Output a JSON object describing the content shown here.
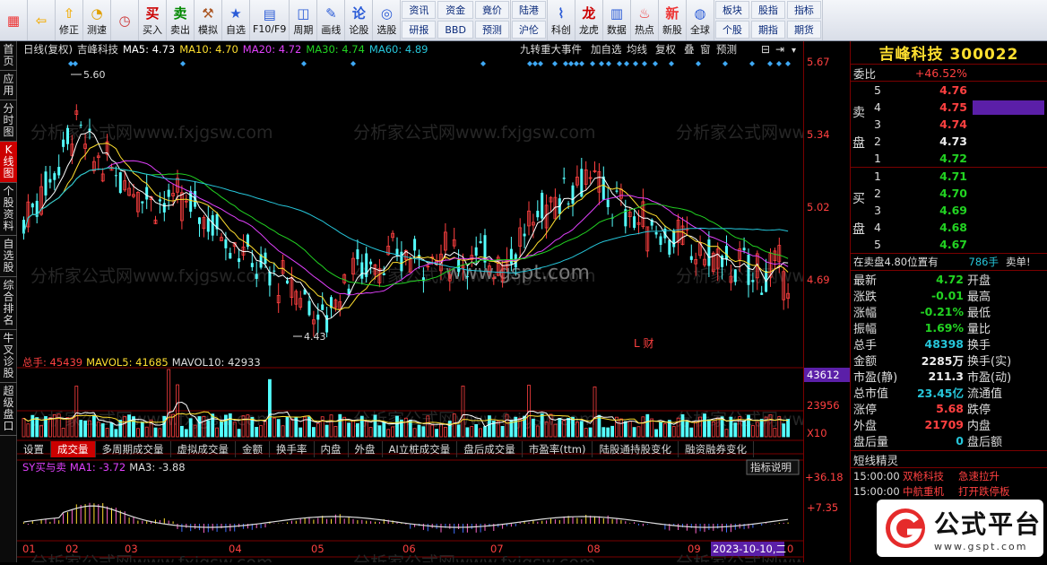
{
  "toolbar": {
    "buttons": [
      {
        "label": "",
        "icon": "grid-icon"
      },
      {
        "label": "",
        "icon": "back-arrow-icon"
      },
      {
        "label": "修正",
        "icon": "up-icon"
      },
      {
        "label": "测速",
        "icon": "speed-icon"
      },
      {
        "label": "",
        "icon": "clock-icon"
      },
      {
        "label": "买入",
        "icon": "buy-icon"
      },
      {
        "label": "卖出",
        "icon": "sell-icon"
      },
      {
        "label": "模拟",
        "icon": "hammer-icon"
      },
      {
        "label": "自选",
        "icon": "star-icon"
      },
      {
        "label": "F10/F9",
        "icon": "f10-icon"
      },
      {
        "label": "周期",
        "icon": "cycle-icon"
      },
      {
        "label": "画线",
        "icon": "pencil-icon"
      },
      {
        "label": "论股",
        "icon": "forum-icon"
      },
      {
        "label": "选股",
        "icon": "pick-icon"
      }
    ],
    "grid1": [
      "资讯",
      "资金",
      "竟价",
      "研报",
      "BBD",
      "预测"
    ],
    "grid1b": [
      "陆港",
      "沪伦"
    ],
    "buttons2": [
      {
        "label": "科创",
        "icon": "kc-icon"
      },
      {
        "label": "龙虎",
        "icon": "dragon-icon"
      },
      {
        "label": "数据",
        "icon": "data-icon"
      },
      {
        "label": "热点",
        "icon": "hot-icon"
      },
      {
        "label": "新股",
        "icon": "newstock-icon"
      },
      {
        "label": "全球",
        "icon": "globe-icon"
      }
    ],
    "grid2": [
      "板块",
      "股指",
      "指标",
      "个股",
      "期指",
      "期货"
    ]
  },
  "leftnav": [
    "首页",
    "应用",
    "分时图",
    "K线图",
    "个股资料",
    "自选股",
    "综合排名",
    "牛叉诊股",
    "超级盘口"
  ],
  "chart": {
    "info_bar": {
      "period": "日线(复权)",
      "name": "吉峰科技",
      "ma5": "MA5: 4.73",
      "ma10": "MA10: 4.70",
      "ma20": "MA20: 4.72",
      "ma30": "MA30: 4.74",
      "ma60": "MA60: 4.89"
    },
    "right_buttons": [
      "九转",
      "重大事件",
      "加自选",
      "均线",
      "复权",
      "叠",
      "窗",
      "预测"
    ],
    "price_ticks": [
      "5.67",
      "5.34",
      "5.02",
      "4.69"
    ],
    "high_label": "5.60",
    "low_label": "4.43",
    "event_tag": "L 财",
    "vol_info": {
      "total": "总手: 45439",
      "mavol5": "MAVOL5: 41685",
      "mavol10": "MAVOL10: 42933"
    },
    "vol_ticks": [
      "43612",
      "23956",
      "X10"
    ],
    "tabs": [
      "设置",
      "成交量",
      "多周期成交量",
      "虚拟成交量",
      "金额",
      "换手率",
      "内盘",
      "外盘",
      "AI立桩成交量",
      "盘后成交量",
      "市盈率(ttm)",
      "陆股通持股变化",
      "融资融券变化"
    ],
    "ind_info": {
      "name": "SY买与卖",
      "ma1": "MA1: -3.72",
      "ma3": "MA3: -3.88"
    },
    "ind_button": "指标说明",
    "ind_ticks": [
      "+36.18",
      "+7.35"
    ],
    "months": [
      "01",
      "02",
      "03",
      "04",
      "05",
      "06",
      "07",
      "08",
      "09"
    ],
    "date_label": "2023-10-10,二",
    "right_zero": "0",
    "watermark_site": "www.gspt.com"
  },
  "quote": {
    "title": "吉峰科技 300022",
    "weibi_label": "委比",
    "weibi": "+46.52%",
    "sell_label": "卖盘",
    "buy_label": "买盘",
    "sells": [
      {
        "lvl": "5",
        "price": "4.76"
      },
      {
        "lvl": "4",
        "price": "4.75"
      },
      {
        "lvl": "3",
        "price": "4.74"
      },
      {
        "lvl": "2",
        "price": "4.73"
      },
      {
        "lvl": "1",
        "price": "4.72"
      }
    ],
    "buys": [
      {
        "lvl": "1",
        "price": "4.71"
      },
      {
        "lvl": "2",
        "price": "4.70"
      },
      {
        "lvl": "3",
        "price": "4.69"
      },
      {
        "lvl": "4",
        "price": "4.68"
      },
      {
        "lvl": "5",
        "price": "4.67"
      }
    ],
    "notice_a": "在卖盘4.80位置有",
    "notice_b": "786手",
    "notice_c": "卖单!",
    "stats": [
      {
        "k": "最新",
        "v": "4.72",
        "k2": "开盘"
      },
      {
        "k": "涨跌",
        "v": "-0.01",
        "k2": "最高"
      },
      {
        "k": "涨幅",
        "v": "-0.21%",
        "k2": "最低"
      },
      {
        "k": "振幅",
        "v": "1.69%",
        "k2": "量比"
      },
      {
        "k": "总手",
        "v": "48398",
        "k2": "换手"
      },
      {
        "k": "金额",
        "v": "2285万",
        "k2": "换手(实)"
      },
      {
        "k": "市盈(静)",
        "v": "211.3",
        "k2": "市盈(动)"
      },
      {
        "k": "总市值",
        "v": "23.45亿",
        "k2": "流通值"
      },
      {
        "k": "涨停",
        "v": "5.68",
        "k2": "跌停"
      },
      {
        "k": "外盘",
        "v": "21709",
        "k2": "内盘"
      },
      {
        "k": "盘后量",
        "v": "0",
        "k2": "盘后额"
      }
    ],
    "news_title": "短线精灵",
    "news": [
      {
        "time": "15:00:00",
        "name": "双枪科技",
        "event": "急速拉升"
      },
      {
        "time": "15:00:00",
        "name": "中航重机",
        "event": "打开跌停板"
      }
    ]
  },
  "logo": {
    "text": "公式平台",
    "url": "www.gspt.com"
  }
}
